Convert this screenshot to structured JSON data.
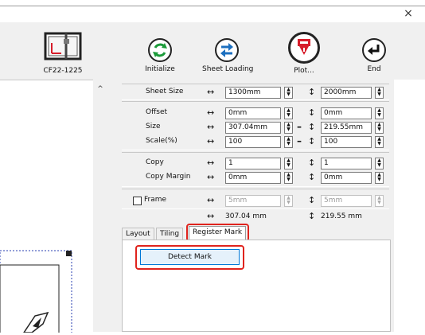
{
  "window": {
    "close_glyph": "×"
  },
  "toolbar": {
    "device_name": "CF22-1225",
    "buttons": [
      {
        "label": "Initialize",
        "icon": "refresh-icon",
        "color": "#1c9b3a"
      },
      {
        "label": "Sheet Loading",
        "icon": "swap-arrows-icon",
        "color": "#1c6fbf"
      },
      {
        "label": "Plot...",
        "icon": "plot-pen-icon",
        "color": "#d71d2b"
      },
      {
        "label": "End",
        "icon": "return-arrow-icon",
        "color": "#111111"
      }
    ]
  },
  "settings": {
    "sheet_size": {
      "label": "Sheet Size",
      "width": "1300mm",
      "height": "2000mm"
    },
    "offset": {
      "label": "Offset",
      "x": "0mm",
      "y": "0mm"
    },
    "size": {
      "label": "Size",
      "x": "307.04mm",
      "y": "219.55mm"
    },
    "scale": {
      "label": "Scale(%)",
      "x": "100",
      "y": "100"
    },
    "copy": {
      "label": "Copy",
      "x": "1",
      "y": "1"
    },
    "copy_margin": {
      "label": "Copy Margin",
      "x": "0mm",
      "y": "0mm"
    },
    "frame": {
      "label": "Frame",
      "checked": false,
      "x": "5mm",
      "y": "5mm"
    },
    "totals": {
      "width": "307.04 mm",
      "height": "219.55 mm"
    }
  },
  "glyphs": {
    "horizontal": "↔",
    "vertical": "↕",
    "link": "–",
    "spin_up": "▲",
    "spin_down": "▼",
    "scroll_up": "^"
  },
  "tabs": {
    "items": [
      {
        "label": "Layout"
      },
      {
        "label": "Tiling"
      },
      {
        "label": "Register Mark",
        "selected": true
      }
    ]
  },
  "register_mark": {
    "detect_button": "Detect Mark"
  },
  "highlight_color": "#e0231d"
}
